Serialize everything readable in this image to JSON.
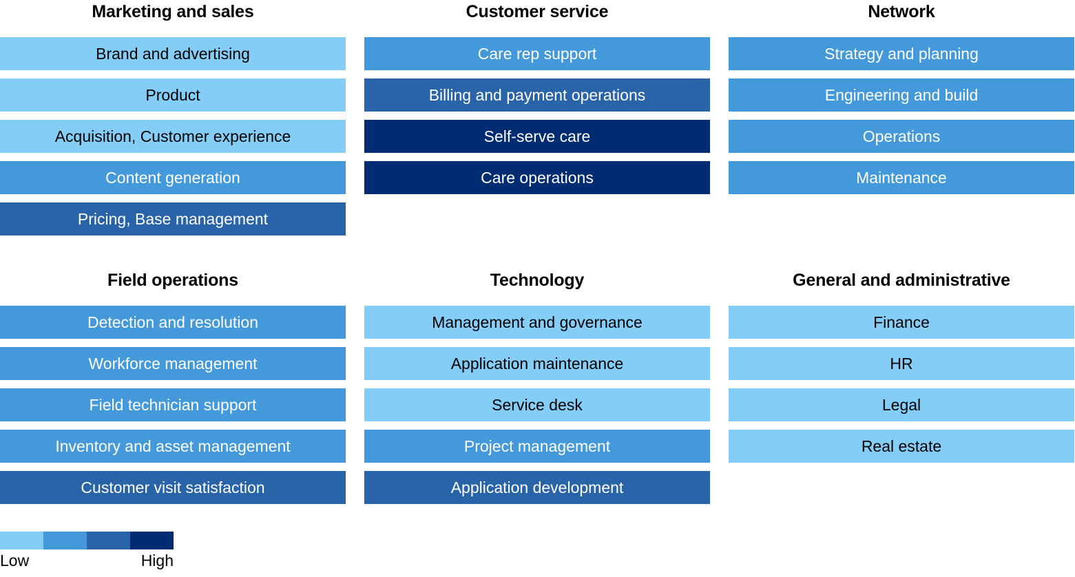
{
  "chart_data": {
    "type": "heatmap",
    "title": "",
    "xlabel": "",
    "ylabel": "",
    "legend": {
      "position": "bottom-left",
      "low_label": "Low",
      "high_label": "High",
      "levels": [
        1,
        2,
        3,
        4
      ],
      "colors": [
        "#84CDF7",
        "#4499DB",
        "#2A64A8",
        "#002D72"
      ]
    },
    "scale_description": "Four-level categorical heat scale from Low (lightest blue) to High (darkest navy)",
    "groups": [
      {
        "name": "Marketing and sales",
        "items": [
          {
            "label": "Brand and advertising",
            "level": 1
          },
          {
            "label": "Product",
            "level": 1
          },
          {
            "label": "Acquisition, Customer experience",
            "level": 1
          },
          {
            "label": "Content generation",
            "level": 2
          },
          {
            "label": "Pricing, Base management",
            "level": 3
          }
        ]
      },
      {
        "name": "Customer service",
        "items": [
          {
            "label": "Care rep support",
            "level": 2
          },
          {
            "label": "Billing and payment operations",
            "level": 3
          },
          {
            "label": "Self-serve care",
            "level": 4
          },
          {
            "label": "Care operations",
            "level": 4
          }
        ]
      },
      {
        "name": "Network",
        "items": [
          {
            "label": "Strategy and planning",
            "level": 2
          },
          {
            "label": "Engineering and build",
            "level": 2
          },
          {
            "label": "Operations",
            "level": 2
          },
          {
            "label": "Maintenance",
            "level": 2
          }
        ]
      },
      {
        "name": "Field operations",
        "items": [
          {
            "label": "Detection and resolution",
            "level": 2
          },
          {
            "label": "Workforce  management",
            "level": 2
          },
          {
            "label": "Field technician support",
            "level": 2
          },
          {
            "label": "Inventory and asset management",
            "level": 2
          },
          {
            "label": "Customer visit satisfaction",
            "level": 3
          }
        ]
      },
      {
        "name": "Technology",
        "items": [
          {
            "label": "Management and governance",
            "level": 1
          },
          {
            "label": "Application maintenance",
            "level": 1
          },
          {
            "label": "Service desk",
            "level": 1
          },
          {
            "label": "Project management",
            "level": 2
          },
          {
            "label": "Application development",
            "level": 3
          }
        ]
      },
      {
        "name": "General and administrative",
        "items": [
          {
            "label": "Finance",
            "level": 1
          },
          {
            "label": "HR",
            "level": 1
          },
          {
            "label": "Legal",
            "level": 1
          },
          {
            "label": "Real estate",
            "level": 1
          }
        ]
      }
    ]
  }
}
